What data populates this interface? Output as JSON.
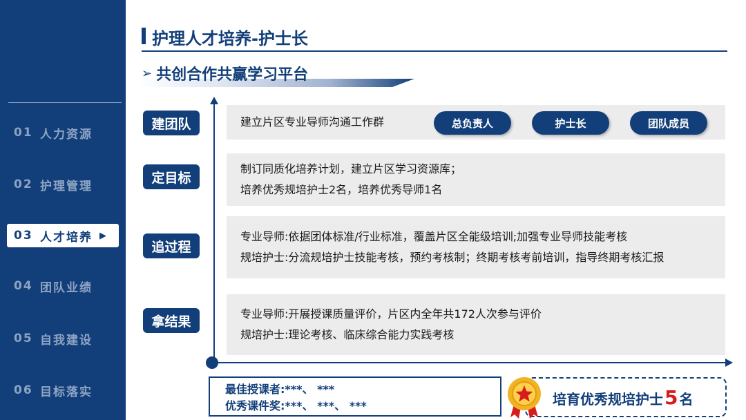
{
  "sidebar": {
    "items": [
      {
        "num": "01",
        "label": "人力资源",
        "active": false
      },
      {
        "num": "02",
        "label": "护理管理",
        "active": false
      },
      {
        "num": "03",
        "label": "人才培养",
        "active": true
      },
      {
        "num": "04",
        "label": "团队业绩",
        "active": false
      },
      {
        "num": "05",
        "label": "自我建设",
        "active": false
      },
      {
        "num": "06",
        "label": "目标落实",
        "active": false
      }
    ],
    "active_arrow": "▶"
  },
  "header": {
    "title": "护理人才培养-护士长",
    "subtitle_chevron": "➢",
    "subtitle": "共创合作共赢学习平台"
  },
  "stages": [
    {
      "label": "建团队",
      "lines": [
        "建立片区专业导师沟通工作群"
      ]
    },
    {
      "label": "定目标",
      "lines": [
        "制订同质化培养计划，建立片区学习资源库；",
        "培养优秀规培护士2名，培养优秀导师1名"
      ]
    },
    {
      "label": "追过程",
      "lines": [
        "专业导师:依据团体标准/行业标准，覆盖片区全能级培训;加强专业导师技能考核",
        "规培护士:分流规培护士技能考核，预约考核制；终期考核考前培训，指导终期考核汇报"
      ]
    },
    {
      "label": "拿结果",
      "lines": [
        "专业导师:开展授课质量评价，片区内全年共172人次参与评价",
        "规培护士:理论考核、临床综合能力实践考核"
      ]
    }
  ],
  "roles": [
    "总负责人",
    "护士长",
    "团队成员"
  ],
  "awards": {
    "line1": "最佳授课者:***、 ***",
    "line2": "优秀课件奖:***、 ***、 ***"
  },
  "cert": {
    "prefix": "培育优秀规培护士",
    "count": "5",
    "suffix": "名"
  },
  "colors": {
    "primary": "#123f7a",
    "box_bg": "#ececec",
    "accent_red": "#d61c1c",
    "medal_gold": "#f0b323"
  }
}
